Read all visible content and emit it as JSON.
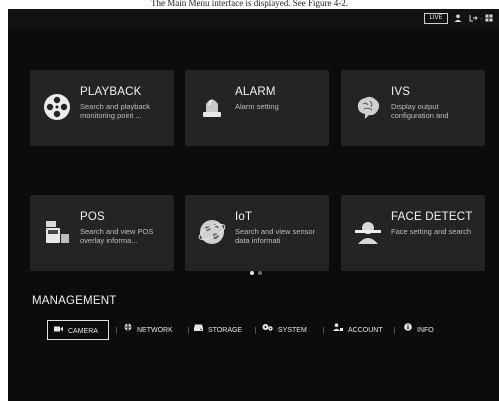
{
  "caption": "The Main Menu interface is displayed. See Figure 4-2.",
  "topbar": {
    "live_label": "LIVE",
    "icons": [
      "user-icon",
      "logout-icon",
      "grid-icon"
    ]
  },
  "tiles": [
    {
      "title": "PLAYBACK",
      "desc": "Search and playback monitoring point ...",
      "icon": "film-reel-icon"
    },
    {
      "title": "ALARM",
      "desc": "Alarm setting",
      "icon": "alarm-beacon-icon"
    },
    {
      "title": "IVS",
      "desc": "Display output configuration and",
      "icon": "brain-icon"
    },
    {
      "title": "POS",
      "desc": "Search and view POS overlay informa...",
      "icon": "pos-terminal-icon"
    },
    {
      "title": "IoT",
      "desc": "Search and view sensor data informati",
      "icon": "globe-icon"
    },
    {
      "title": "FACE DETECT",
      "desc": "Face setting and search",
      "icon": "face-detect-icon"
    }
  ],
  "pager": {
    "pages": 2,
    "current": 1
  },
  "management": {
    "title": "MANAGEMENT",
    "items": [
      {
        "label": "CAMERA",
        "icon": "camera-icon",
        "active": true
      },
      {
        "label": "NETWORK",
        "icon": "network-icon",
        "active": false
      },
      {
        "label": "STORAGE",
        "icon": "storage-icon",
        "active": false
      },
      {
        "label": "SYSTEM",
        "icon": "gears-icon",
        "active": false
      },
      {
        "label": "ACCOUNT",
        "icon": "account-icon",
        "active": false
      },
      {
        "label": "INFO",
        "icon": "info-icon",
        "active": false
      }
    ]
  },
  "colors": {
    "background": "#0c0c0c",
    "tile": "#242424",
    "text": "#f2f2f2",
    "subtext": "#bdbdbd"
  }
}
